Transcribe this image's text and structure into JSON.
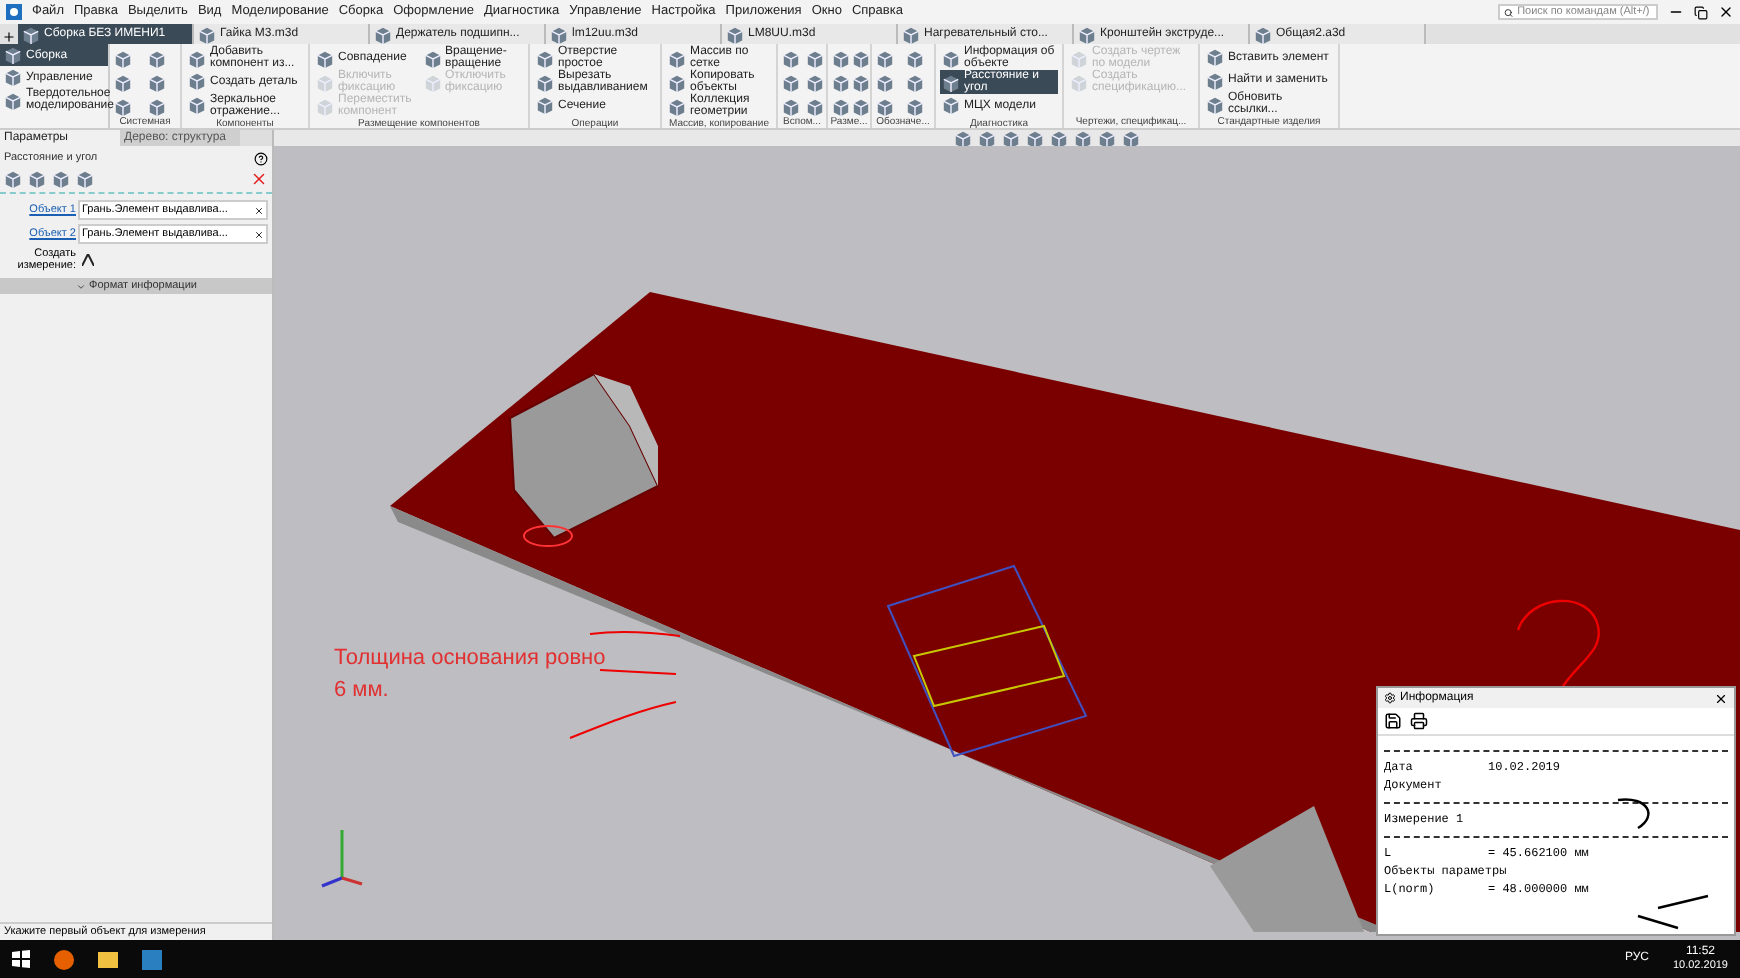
{
  "menu": [
    "Файл",
    "Правка",
    "Выделить",
    "Вид",
    "Моделирование",
    "Сборка",
    "Оформление",
    "Диагностика",
    "Управление",
    "Настройка",
    "Приложения",
    "Окно",
    "Справка"
  ],
  "search": {
    "placeholder": "Поиск по командам (Alt+/)"
  },
  "tabs": [
    {
      "label": "Сборка БЕЗ ИМЕНИ1",
      "selected": true
    },
    {
      "label": "Гайка М3.m3d",
      "selected": false
    },
    {
      "label": "Держатель подшипн...",
      "selected": false
    },
    {
      "label": "lm12uu.m3d",
      "selected": false
    },
    {
      "label": "LM8UU.m3d",
      "selected": false
    },
    {
      "label": "Нагревательный сто...",
      "selected": false
    },
    {
      "label": "Кронштейн экструде...",
      "selected": false
    },
    {
      "label": "Общая2.a3d",
      "selected": false
    }
  ],
  "sections": [
    {
      "label": "Сборка",
      "selected": true
    },
    {
      "label": "Управление",
      "selected": false
    },
    {
      "label": "Твердотельное моделирование",
      "selected": false
    }
  ],
  "ribbon": [
    {
      "kind": "icons",
      "label": "Системная"
    },
    {
      "kind": "commands",
      "label": "Компоненты",
      "items": [
        {
          "label": "Добавить компонент из...",
          "disabled": false,
          "selected": false
        },
        {
          "label": "Создать деталь",
          "disabled": false,
          "selected": false
        },
        {
          "label": "Зеркальное отражение...",
          "disabled": false,
          "selected": false
        }
      ]
    },
    {
      "kind": "commands",
      "label": "Размещение компонентов",
      "items": [
        {
          "label": "Совпадение",
          "disabled": false,
          "selected": false
        },
        {
          "label": "Включить фиксацию",
          "disabled": true,
          "selected": false
        },
        {
          "label": "Переместить компонент",
          "disabled": true,
          "selected": false
        },
        {
          "label": "Вращение-вращение",
          "disabled": false,
          "selected": false
        },
        {
          "label": "Отключить фиксацию",
          "disabled": true,
          "selected": false
        }
      ]
    },
    {
      "kind": "commands",
      "label": "Операции",
      "items": [
        {
          "label": "Отверстие простое",
          "disabled": false,
          "selected": false
        },
        {
          "label": "Вырезать выдавливанием",
          "disabled": false,
          "selected": false
        },
        {
          "label": "Сечение",
          "disabled": false,
          "selected": false
        }
      ]
    },
    {
      "kind": "commands",
      "label": "Массив, копирование",
      "items": [
        {
          "label": "Массив по сетке",
          "disabled": false,
          "selected": false
        },
        {
          "label": "Копировать объекты",
          "disabled": false,
          "selected": false
        },
        {
          "label": "Коллекция геометрии",
          "disabled": false,
          "selected": false
        }
      ]
    },
    {
      "kind": "icons",
      "label": "Вспом..."
    },
    {
      "kind": "icons",
      "label": "Разме..."
    },
    {
      "kind": "icons",
      "label": "Обозначе..."
    },
    {
      "kind": "commands",
      "label": "Диагностика",
      "items": [
        {
          "label": "Информация об объекте",
          "disabled": false,
          "selected": false
        },
        {
          "label": "Расстояние и угол",
          "disabled": false,
          "selected": true
        },
        {
          "label": "МЦХ модели",
          "disabled": false,
          "selected": false
        }
      ]
    },
    {
      "kind": "commands",
      "label": "Чертежи, спецификац...",
      "items": [
        {
          "label": "Создать чертеж по модели",
          "disabled": true,
          "selected": false
        },
        {
          "label": "Создать спецификацию...",
          "disabled": true,
          "selected": false
        }
      ]
    },
    {
      "kind": "commands",
      "label": "Стандартные изделия",
      "items": [
        {
          "label": "Вставить элемент",
          "disabled": false,
          "selected": false
        },
        {
          "label": "Найти и заменить",
          "disabled": false,
          "selected": false
        },
        {
          "label": "Обновить ссылки...",
          "disabled": false,
          "selected": false
        }
      ]
    }
  ],
  "panel": {
    "tabs": [
      {
        "label": "Параметры",
        "selected": true
      },
      {
        "label": "Дерево: структура",
        "selected": false
      }
    ],
    "title": "Расстояние и угол",
    "fields": [
      {
        "label": "Объект 1",
        "value": "Грань.Элемент выдавлива..."
      },
      {
        "label": "Объект 2",
        "value": "Грань.Элемент выдавлива..."
      }
    ],
    "create_label": "Создать измерение:",
    "section": {
      "label": "Формат информации",
      "expanded": false
    }
  },
  "status": "Укажите первый объект для измерения",
  "annotation": "Толщина основания ровно 6 мм.",
  "info_window": {
    "title": "Информация",
    "lines": [
      {
        "kind": "rule"
      },
      {
        "kind": "pair",
        "key": "Дата",
        "value": "10.02.2019"
      },
      {
        "kind": "text",
        "text": "Документ"
      },
      {
        "kind": "rule"
      },
      {
        "kind": "text",
        "text": "Измерение 1"
      },
      {
        "kind": "rule"
      },
      {
        "kind": "pair",
        "key": "L",
        "value": "= 45.662100 мм"
      },
      {
        "kind": "text",
        "text": "Объекты параметры"
      },
      {
        "kind": "pair",
        "key": "L(norm)",
        "value": "= 48.000000 мм"
      }
    ]
  },
  "taskbar": {
    "language": "РУС",
    "time": "11:52",
    "date": "10.02.2019"
  }
}
